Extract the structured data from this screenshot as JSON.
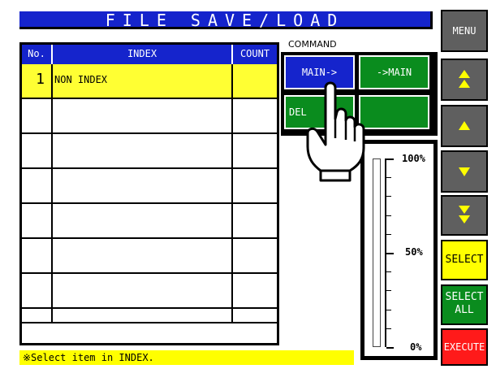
{
  "title": "FILE SAVE/LOAD",
  "table": {
    "headers": {
      "no": "No.",
      "index": "INDEX",
      "count": "COUNT"
    },
    "rows": [
      {
        "no": "1",
        "index": "NON INDEX",
        "count": ""
      },
      {
        "no": "",
        "index": "",
        "count": ""
      },
      {
        "no": "",
        "index": "",
        "count": ""
      },
      {
        "no": "",
        "index": "",
        "count": ""
      },
      {
        "no": "",
        "index": "",
        "count": ""
      },
      {
        "no": "",
        "index": "",
        "count": ""
      },
      {
        "no": "",
        "index": "",
        "count": ""
      },
      {
        "no": "",
        "index": "",
        "count": ""
      }
    ]
  },
  "command": {
    "label": "COMMAND",
    "buttons": {
      "main_to": "MAIN->",
      "to_main": "->MAIN",
      "del": "DEL",
      "blank": ""
    }
  },
  "progress": {
    "label_100": "100%",
    "label_50": "50%",
    "label_0": "0%",
    "value_percent": 0
  },
  "right_buttons": {
    "menu": "MENU",
    "page_up_icon": "double-up-arrow",
    "up_icon": "up-arrow",
    "down_icon": "down-arrow",
    "page_down_icon": "double-down-arrow",
    "select": "SELECT",
    "select_all_1": "SELECT",
    "select_all_2": "ALL",
    "execute": "EXECUTE"
  },
  "status": "※Select item in INDEX.",
  "colors": {
    "header_blue": "#1524cc",
    "highlight_yellow": "#ffff33",
    "green": "#0a8c1e",
    "red": "#ff1a1a",
    "gray": "#5f5f5f"
  }
}
